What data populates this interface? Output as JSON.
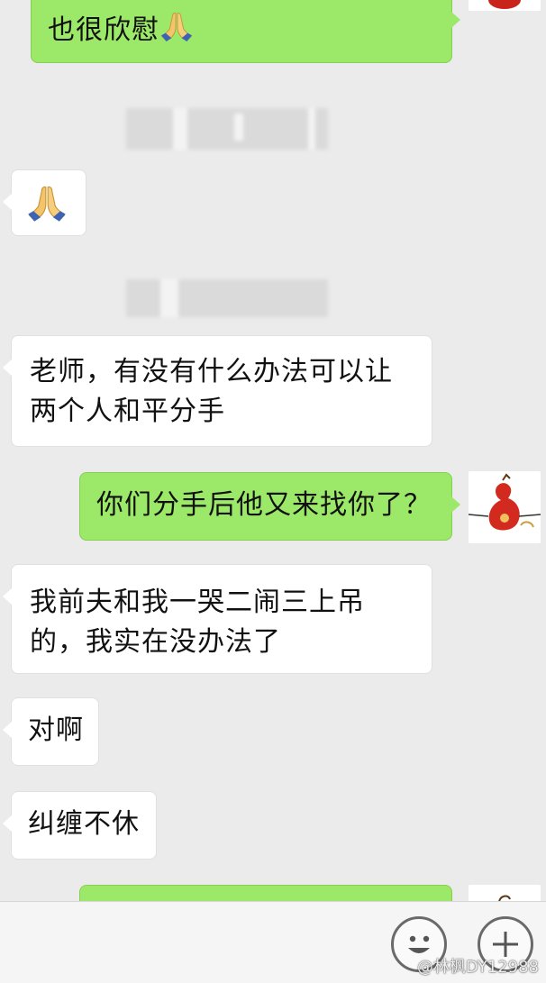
{
  "chat": {
    "messages": [
      {
        "side": "out",
        "lines": [
          "也很欣慰"
        ],
        "emoji": "praying-hands"
      },
      {
        "side": "in",
        "emoji": "praying-hands"
      },
      {
        "side": "in",
        "lines": [
          "老师，有没有什么办法可以让",
          "两个人和平分手"
        ]
      },
      {
        "side": "out",
        "lines": [
          "你们分手后他又来找你了？"
        ]
      },
      {
        "side": "in",
        "lines": [
          "我前夫和我一哭二闹三上吊",
          "的，我实在没办法了"
        ]
      },
      {
        "side": "in",
        "lines": [
          "对啊"
        ]
      },
      {
        "side": "in",
        "lines": [
          "纠缠不休"
        ]
      },
      {
        "side": "out",
        "lines": []
      }
    ]
  },
  "input_bar": {
    "emoji_icon": "smiley-face-icon",
    "plus_icon": "plus-icon"
  },
  "watermark": {
    "text": "@林枫DY12988"
  },
  "colors": {
    "background": "#ebebeb",
    "outgoing_bubble": "#9ce868",
    "incoming_bubble": "#ffffff"
  }
}
